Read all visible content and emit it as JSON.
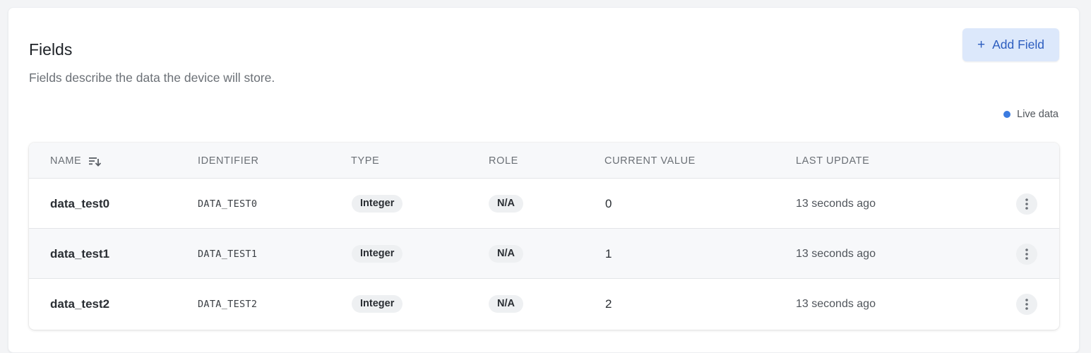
{
  "header": {
    "title": "Fields",
    "subtitle": "Fields describe the data the device will store.",
    "add_button_label": "Add Field",
    "add_button_icon": "plus-icon"
  },
  "live_indicator": {
    "label": "Live data",
    "dot_color": "#3b7be0"
  },
  "table": {
    "columns": [
      "NAME",
      "IDENTIFIER",
      "TYPE",
      "ROLE",
      "CURRENT VALUE",
      "LAST UPDATE"
    ],
    "sort_icon": "sort-descending-icon",
    "row_menu_icon": "more-vertical-icon",
    "rows": [
      {
        "name": "data_test0",
        "identifier": "DATA_TEST0",
        "type": "Integer",
        "role": "N/A",
        "current_value": "0",
        "last_update": "13 seconds ago"
      },
      {
        "name": "data_test1",
        "identifier": "DATA_TEST1",
        "type": "Integer",
        "role": "N/A",
        "current_value": "1",
        "last_update": "13 seconds ago"
      },
      {
        "name": "data_test2",
        "identifier": "DATA_TEST2",
        "type": "Integer",
        "role": "N/A",
        "current_value": "2",
        "last_update": "13 seconds ago"
      }
    ]
  },
  "colors": {
    "accent": "#2c5dbf",
    "button_bg": "#dce8fb"
  }
}
